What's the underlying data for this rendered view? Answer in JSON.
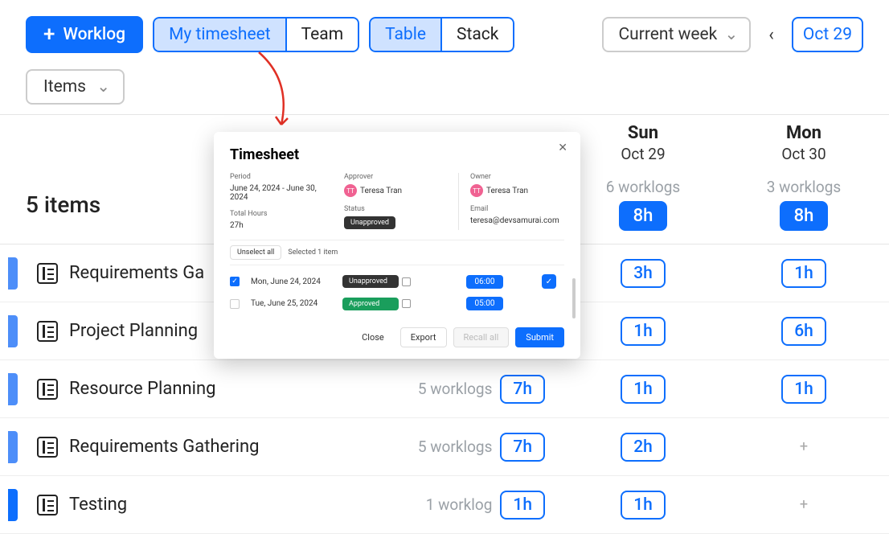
{
  "toolbar": {
    "worklog": "Worklog",
    "seg_scope": {
      "my": "My timesheet",
      "team": "Team"
    },
    "seg_view": {
      "table": "Table",
      "stack": "Stack"
    },
    "period": "Current week",
    "date_btn": "Oct 29"
  },
  "subbar": {
    "items": "Items"
  },
  "days": [
    {
      "name": "Sun",
      "date": "Oct 29",
      "worklogs": "6 worklogs",
      "total": "8h"
    },
    {
      "name": "Mon",
      "date": "Oct 30",
      "worklogs": "3 worklogs",
      "total": "8h"
    }
  ],
  "summary": {
    "count": "5 items"
  },
  "rows": [
    {
      "name": "Requirements Ga",
      "mid_count": "",
      "mid_total": "",
      "sun": "3h",
      "mon": "1h"
    },
    {
      "name": "Project Planning",
      "mid_count": "",
      "mid_total": "",
      "sun": "1h",
      "mon": "6h"
    },
    {
      "name": "Resource Planning",
      "mid_count": "5 worklogs",
      "mid_total": "7h",
      "sun": "1h",
      "mon": "1h"
    },
    {
      "name": "Requirements Gathering",
      "mid_count": "5 worklogs",
      "mid_total": "7h",
      "sun": "2h",
      "mon": "+"
    },
    {
      "name": "Testing",
      "mid_count": "1 worklog",
      "mid_total": "1h",
      "sun": "1h",
      "mon": "+"
    }
  ],
  "modal": {
    "title": "Timesheet",
    "meta": {
      "period_label": "Period",
      "period": "June 24, 2024 - June 30, 2024",
      "total_label": "Total Hours",
      "total": "27h",
      "approver_label": "Approver",
      "approver_initials": "TT",
      "approver": "Teresa Tran",
      "status_label": "Status",
      "status": "Unapproved",
      "owner_label": "Owner",
      "owner_initials": "TT",
      "owner": "Teresa Tran",
      "email_label": "Email",
      "email": "teresa@devsamurai.com"
    },
    "bar": {
      "unselect": "Unselect all",
      "selected": "Selected 1 item"
    },
    "entries": [
      {
        "checked": true,
        "date": "Mon, June 24, 2024",
        "status": "Unapproved",
        "status_kind": "dark",
        "time": "06:00",
        "flag": true
      },
      {
        "checked": false,
        "date": "Tue, June 25, 2024",
        "status": "Approved",
        "status_kind": "green",
        "time": "05:00",
        "flag": false
      }
    ],
    "footer": {
      "close": "Close",
      "export": "Export",
      "recall": "Recall all",
      "submit": "Submit"
    }
  }
}
